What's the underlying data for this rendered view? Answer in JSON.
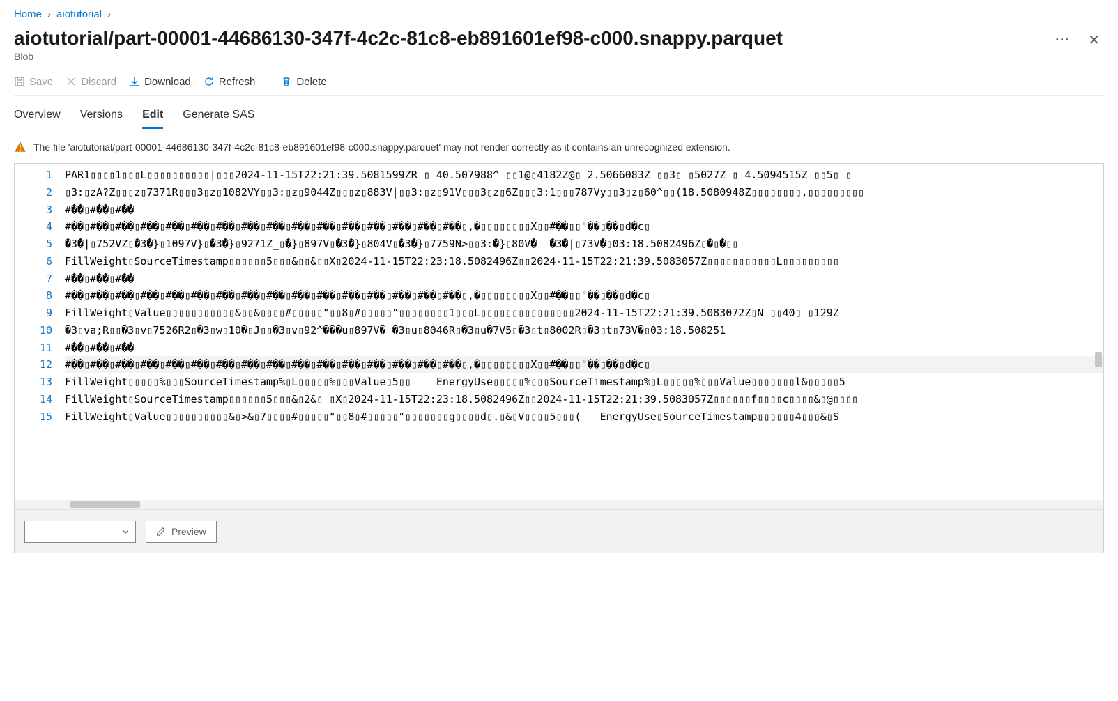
{
  "breadcrumb": {
    "home": "Home",
    "folder": "aiotutorial"
  },
  "title": "aiotutorial/part-00001-44686130-347f-4c2c-81c8-eb891601ef98-c000.snappy.parquet",
  "subtitle": "Blob",
  "toolbar": {
    "save": "Save",
    "discard": "Discard",
    "download": "Download",
    "refresh": "Refresh",
    "delete": "Delete"
  },
  "tabs": {
    "overview": "Overview",
    "versions": "Versions",
    "edit": "Edit",
    "generate_sas": "Generate SAS"
  },
  "warning": "The file 'aiotutorial/part-00001-44686130-347f-4c2c-81c8-eb891601ef98-c000.snappy.parquet' may not render correctly as it contains an unrecognized extension.",
  "footer": {
    "preview": "Preview"
  },
  "code_lines": [
    "PAR1▯▯▯▯1▯▯▯L▯▯▯▯▯▯▯▯▯▯|▯▯▯2024-11-15T22:21:39.5081599ZR ▯ 40.507988^ ▯▯1@▯4182Z@▯ 2.5066083Z ▯▯3▯ ▯5027Z ▯ 4.5094515Z ▯▯5▯ ▯",
    "▯3:▯zA?Z▯▯▯z▯7371R▯▯▯3▯z▯1082VY▯▯3:▯z▯9044Z▯▯▯z▯883V|▯▯3:▯z▯91V▯▯▯3▯z▯6Z▯▯▯3:1▯▯▯787Vy▯▯3▯z▯60^▯▯(18.5080948Z▯▯▯▯▯▯▯▯,▯▯▯▯▯▯▯▯▯",
    "#��▯#��▯#��",
    "#��▯#��▯#��▯#��▯#��▯#��▯#��▯#��▯#��▯#��▯#��▯#��▯#��▯#��▯#��▯#��▯,�▯▯▯▯▯▯▯▯X▯▯#��▯▯\"��▯��▯d�c▯",
    "�3�|▯752VZ▯�3�}▯1097V}▯�3�}▯9271Z_▯�}▯897V▯�3�}▯804V▯�3�}▯7759N>▯▯3:�}▯80V�  �3�|▯73V�▯03:18.5082496Z▯�▯�▯▯",
    "FillWeight▯SourceTimestamp▯▯▯▯▯▯5▯▯▯&▯▯&▯▯X▯2024-11-15T22:23:18.5082496Z▯▯2024-11-15T22:21:39.5083057Z▯▯▯▯▯▯▯▯▯▯▯L▯▯▯▯▯▯▯▯▯",
    "#��▯#��▯#��",
    "#��▯#��▯#��▯#��▯#��▯#��▯#��▯#��▯#��▯#��▯#��▯#��▯#��▯#��▯#��▯#��▯,�▯▯▯▯▯▯▯▯X▯▯#��▯▯\"��▯��▯d�c▯",
    "FillWeight▯Value▯▯▯▯▯▯▯▯▯▯▯&▯▯&▯▯▯▯#▯▯▯▯▯\"▯▯8▯#▯▯▯▯▯\"▯▯▯▯▯▯▯▯1▯▯▯L▯▯▯▯▯▯▯▯▯▯▯▯▯▯▯2024-11-15T22:21:39.5083072Z▯N ▯▯40▯ ▯129Z",
    "�3▯va;R▯▯�3▯v▯7526R2▯�3▯w▯10�▯J▯▯�3▯v▯92^���u▯897V� �3▯u▯8046R▯�3▯u�7V5▯�3▯t▯8002R▯�3▯t▯73V�▯03:18.508251",
    "#��▯#��▯#��",
    "#��▯#��▯#��▯#��▯#��▯#��▯#��▯#��▯#��▯#��▯#��▯#��▯#��▯#��▯#��▯#��▯,�▯▯▯▯▯▯▯▯X▯▯#��▯▯\"��▯��▯d�c▯",
    "FillWeight▯▯▯▯▯%▯▯▯SourceTimestamp%▯L▯▯▯▯▯%▯▯▯Value▯5▯▯    EnergyUse▯▯▯▯▯%▯▯▯SourceTimestamp%▯L▯▯▯▯▯%▯▯▯Value▯▯▯▯▯▯▯l&▯▯▯▯▯5",
    "FillWeight▯SourceTimestamp▯▯▯▯▯▯5▯▯▯&▯2&▯ ▯X▯2024-11-15T22:23:18.5082496Z▯▯2024-11-15T22:21:39.5083057Z▯▯▯▯▯▯f▯▯▯▯c▯▯▯▯&▯@▯▯▯▯",
    "FillWeight▯Value▯▯▯▯▯▯▯▯▯▯&▯>&▯7▯▯▯▯#▯▯▯▯▯\"▯▯8▯#▯▯▯▯▯\"▯▯▯▯▯▯▯g▯▯▯▯d▯.▯&▯V▯▯▯▯5▯▯▯(   EnergyUse▯SourceTimestamp▯▯▯▯▯▯4▯▯▯&▯S"
  ]
}
